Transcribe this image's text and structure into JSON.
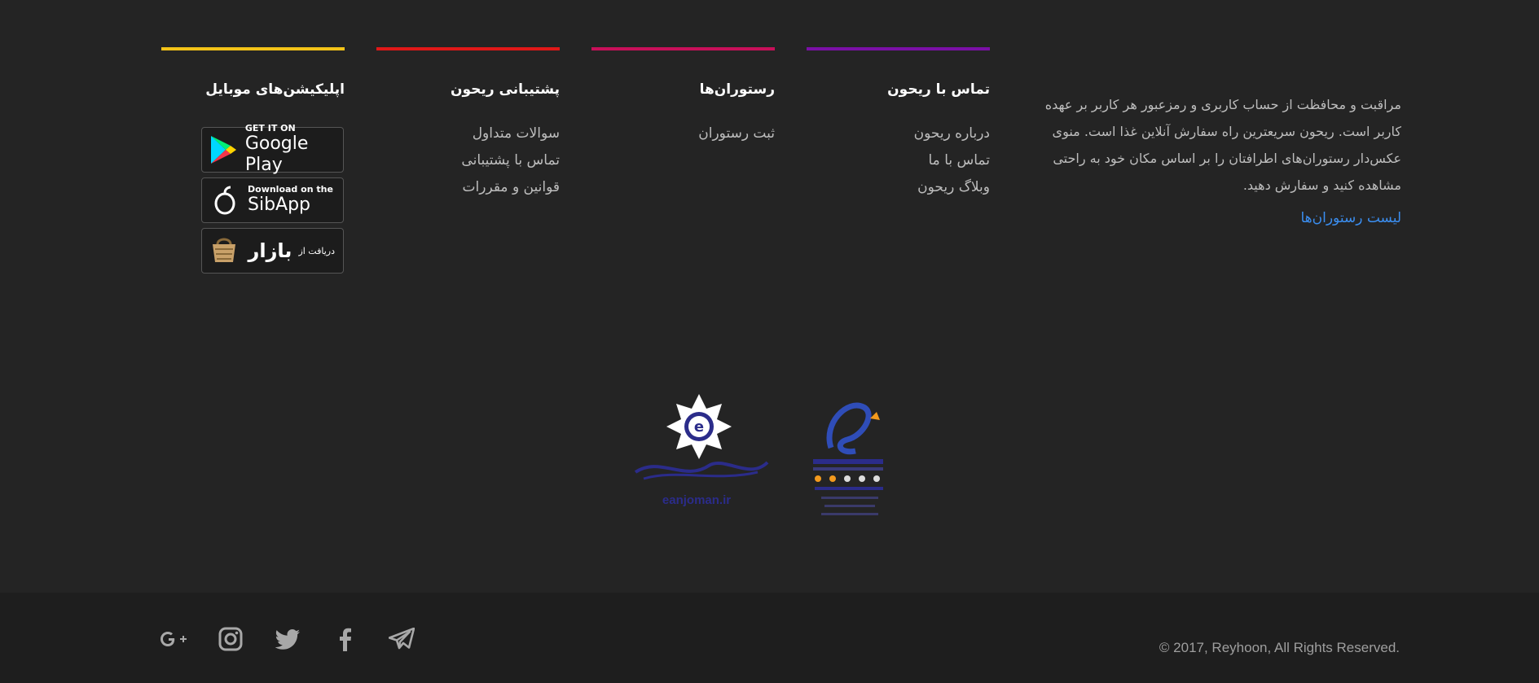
{
  "about": {
    "text": "مراقبت و محافظت از حساب کاربری و رمزعبور هر کاربر بر عهده کاربر است. ریحون سریعترین راه سفارش آنلاین غذا است. منوی عکس‌دار رستوران‌های اطرافتان را بر اساس مکان خود به راحتی مشاهده کنید و سفارش دهید.",
    "link": "لیست رستوران‌ها",
    "link_color": "#3b8ef0"
  },
  "columns": {
    "contact": {
      "title": "تماس با ریحون",
      "accent": "#7b10a6",
      "items": [
        "درباره ریحون",
        "تماس با ما",
        "وبلاگ ریحون"
      ]
    },
    "restaurants": {
      "title": "رستوران‌ها",
      "accent": "#c8105a",
      "items": [
        "ثبت رستوران"
      ]
    },
    "support": {
      "title": "پشتیبانی ریحون",
      "accent": "#e01818",
      "items": [
        "سوالات متداول",
        "تماس با پشتیبانی",
        "قوانین و مقررات"
      ]
    },
    "apps": {
      "title": "اپلیکیشن‌های موبایل",
      "accent": "#f3c318"
    }
  },
  "badges": {
    "google": {
      "small": "GET IT ON",
      "big": "Google Play",
      "icon": "google-play-icon"
    },
    "sibapp": {
      "small": "Download on the",
      "big": "SibApp",
      "icon": "apple-icon"
    },
    "bazaar": {
      "small": "دریافت از",
      "big": "بازار",
      "icon": "bazaar-bag-icon"
    }
  },
  "trust": {
    "anjoman_url": "eanjoman.ir"
  },
  "social": [
    "google-plus-icon",
    "instagram-icon",
    "twitter-icon",
    "facebook-icon",
    "telegram-icon"
  ],
  "copyright": "© 2017, Reyhoon, All Rights Reserved."
}
